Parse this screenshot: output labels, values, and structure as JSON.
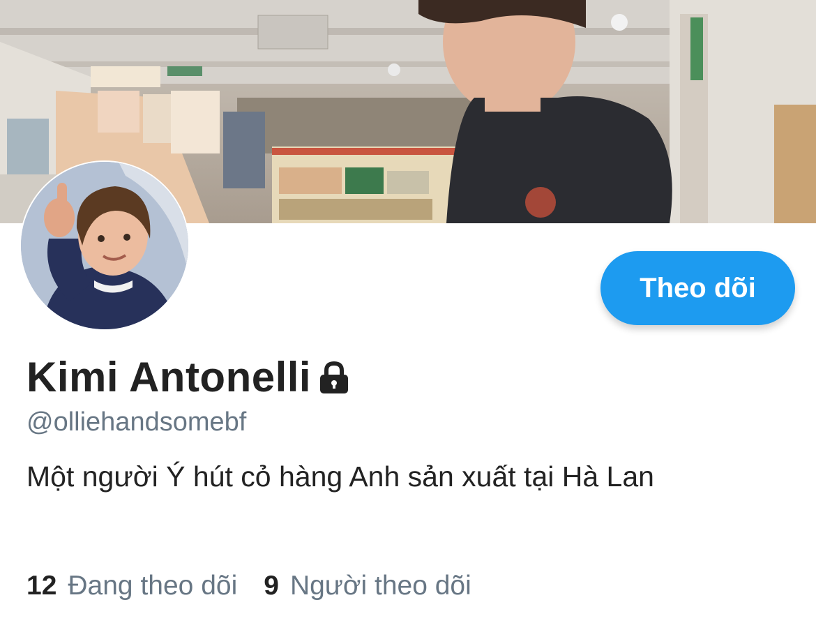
{
  "profile": {
    "display_name": "Kimi Antonelli",
    "handle": "@olliehandsomebf",
    "bio": "Một người Ý hút cỏ hàng Anh sản xuất tại Hà Lan",
    "locked_icon": "lock-icon"
  },
  "actions": {
    "follow_label": "Theo dõi"
  },
  "stats": {
    "following_count": "12",
    "following_label": "Đang theo dõi",
    "followers_count": "9",
    "followers_label": "Người theo dõi"
  },
  "colors": {
    "accent": "#1d9bf0",
    "text_primary": "#222222",
    "text_secondary": "#677684"
  }
}
